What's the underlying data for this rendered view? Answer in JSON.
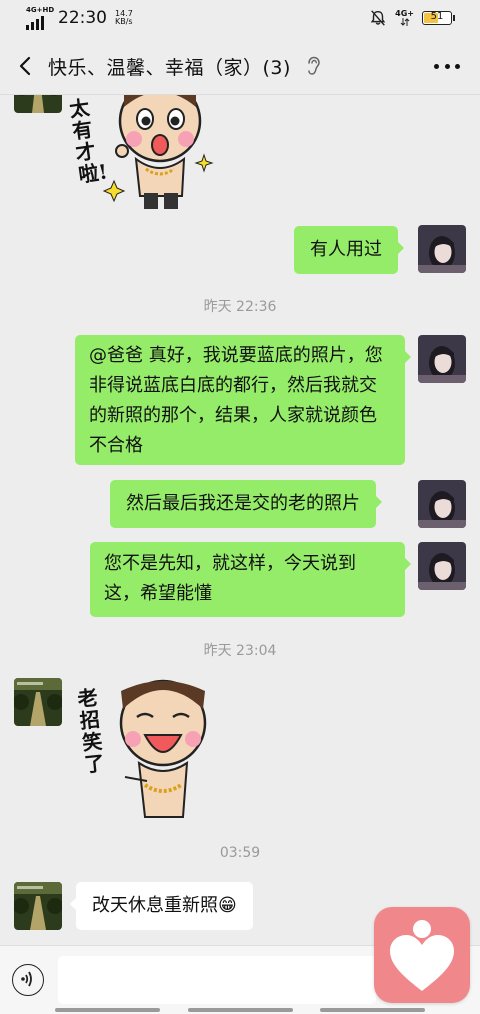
{
  "status_bar": {
    "signal_label": "4G+HD",
    "time": "22:30",
    "speed_value": "14.7",
    "speed_unit": "KB/s",
    "network_label": "4G+",
    "battery_percent": "51",
    "battery_level": 0.51
  },
  "header": {
    "title": "快乐、温馨、幸福（家）(3)",
    "icons": {
      "back": "back-arrow-icon",
      "mute": "ear-icon",
      "more": "more-dots-icon"
    }
  },
  "messages": {
    "m1": {
      "text": "有人用过"
    },
    "t1": {
      "text": "昨天 22:36"
    },
    "m2": {
      "text": "@爸爸  真好，我说要蓝底的照片，您非得说蓝底白底的都行，然后我就交的新照的那个，结果，人家就说颜色不合格"
    },
    "m3": {
      "text": "然后最后我还是交的老的照片"
    },
    "m4": {
      "text": "您不是先知，就这样，今天说到这，希望能懂"
    },
    "t2": {
      "text": "昨天 23:04"
    },
    "sticker1": {
      "caption": "太有才啦!"
    },
    "sticker2": {
      "caption": "老招笑了"
    },
    "t3": {
      "text": "03:59"
    },
    "m5": {
      "text": "改天休息重新照",
      "emoji": "😁"
    }
  },
  "input_bar": {
    "placeholder": "",
    "voice_icon": "voice-input-icon"
  },
  "floating_button": {
    "icon": "heart-icon"
  },
  "colors": {
    "background": "#ededed",
    "bubble_self": "#95ec69",
    "bubble_other": "#ffffff",
    "timestamp": "#9a9a9a",
    "floater": "#f0888b"
  }
}
